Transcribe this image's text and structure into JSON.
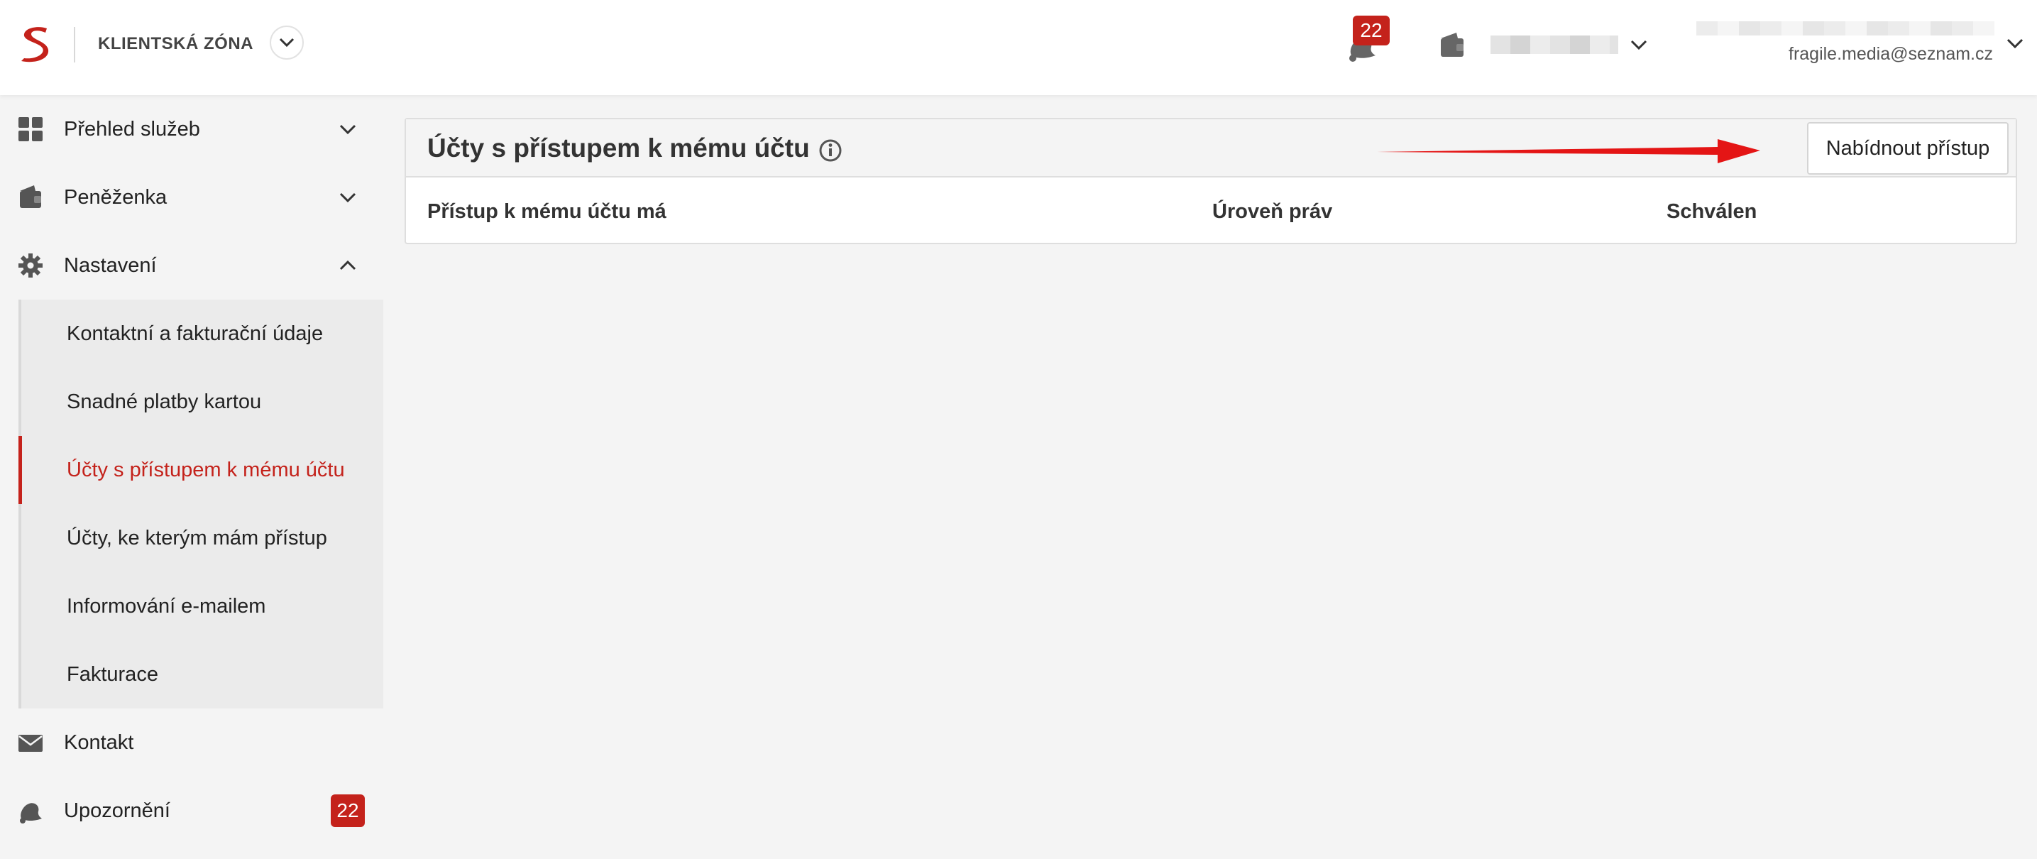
{
  "header": {
    "zone_title": "KLIENTSKÁ ZÓNA",
    "notification_count": "22",
    "user_email": "fragile.media@seznam.cz"
  },
  "sidebar": {
    "items": [
      {
        "label": "Přehled služeb",
        "icon": "grid-icon"
      },
      {
        "label": "Peněženka",
        "icon": "wallet-icon"
      },
      {
        "label": "Nastavení",
        "icon": "gear-icon"
      },
      {
        "label": "Kontakt",
        "icon": "envelope-icon"
      },
      {
        "label": "Upozornění",
        "icon": "bell-icon",
        "badge": "22"
      }
    ],
    "subitems": [
      {
        "label": "Kontaktní a fakturační údaje"
      },
      {
        "label": "Snadné platby kartou"
      },
      {
        "label": "Účty s přístupem k mému účtu",
        "active": true
      },
      {
        "label": "Účty, ke kterým mám přístup"
      },
      {
        "label": "Informování e-mailem"
      },
      {
        "label": "Fakturace"
      }
    ]
  },
  "main": {
    "title": "Účty s přístupem k mému účtu",
    "offer_button": "Nabídnout přístup",
    "columns": [
      "Přístup k mému účtu má",
      "Úroveň práv",
      "Schválen"
    ]
  },
  "colors": {
    "accent": "#c4221b",
    "arrow": "#e41515"
  }
}
